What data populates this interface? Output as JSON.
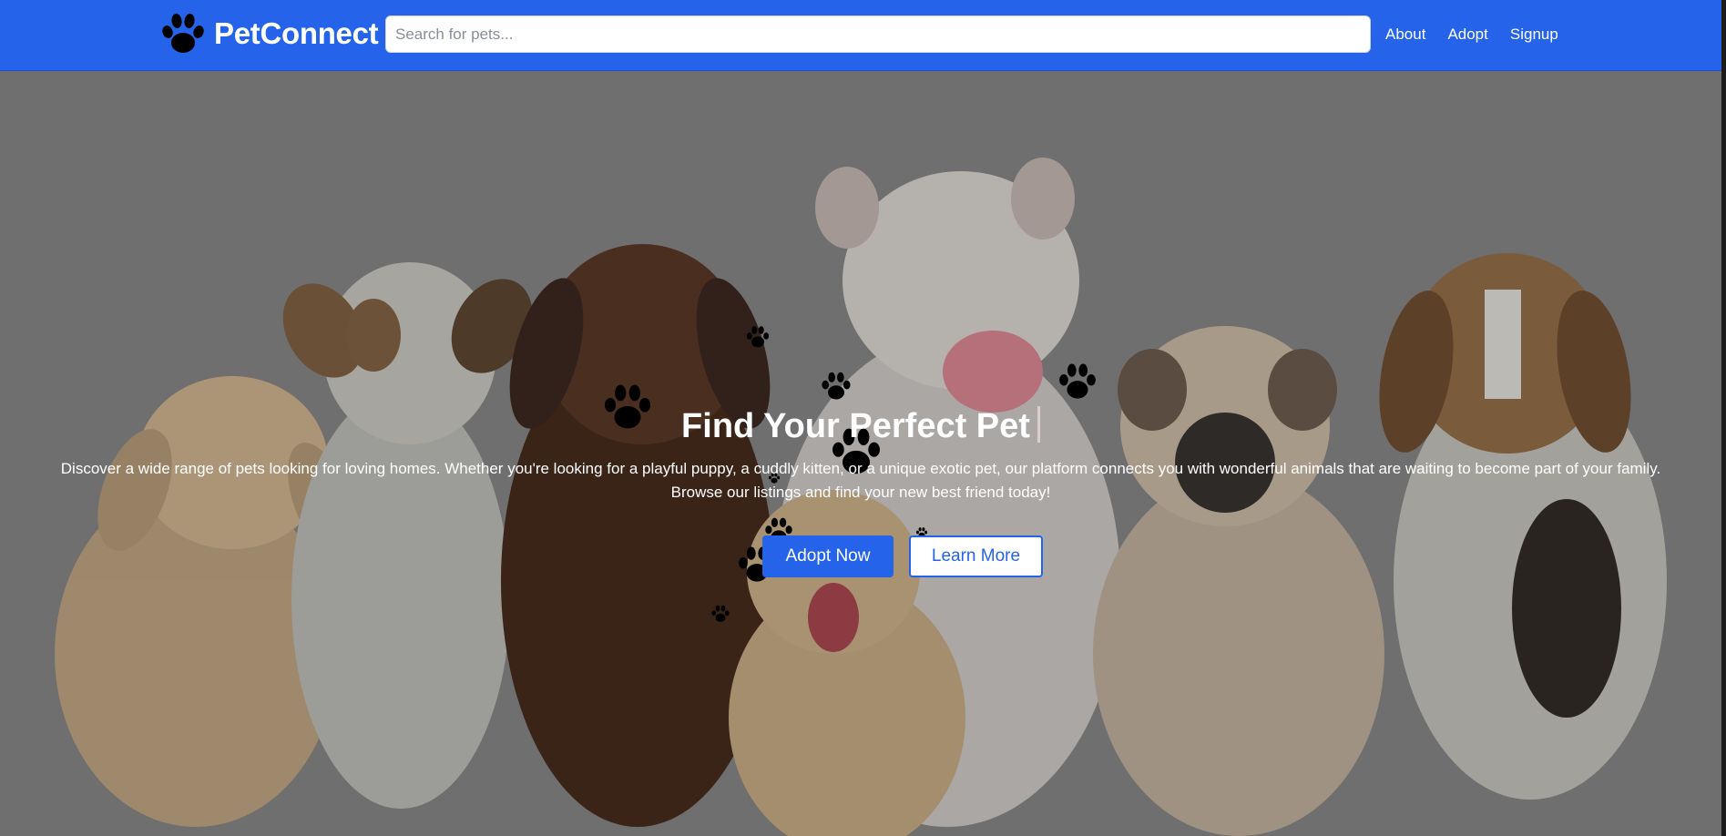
{
  "brand": {
    "name": "PetConnect",
    "logo_icon": "paw-icon"
  },
  "search": {
    "placeholder": "Search for pets...",
    "value": ""
  },
  "nav": {
    "links": [
      "About",
      "Adopt",
      "Signup"
    ]
  },
  "hero": {
    "title": "Find Your Perfect Pet",
    "description": "Discover a wide range of pets looking for loving homes. Whether you're looking for a playful puppy, a cuddly kitten, or a unique exotic pet, our platform connects you with wonderful animals that are waiting to become part of your family. Browse our listings and find your new best friend today!",
    "primary_button": "Adopt Now",
    "secondary_button": "Learn More",
    "background_image": "group of puppies"
  },
  "colors": {
    "accent": "#2563eb",
    "nav_text": "#ffffff",
    "hero_overlay": "#6b6b6b"
  }
}
